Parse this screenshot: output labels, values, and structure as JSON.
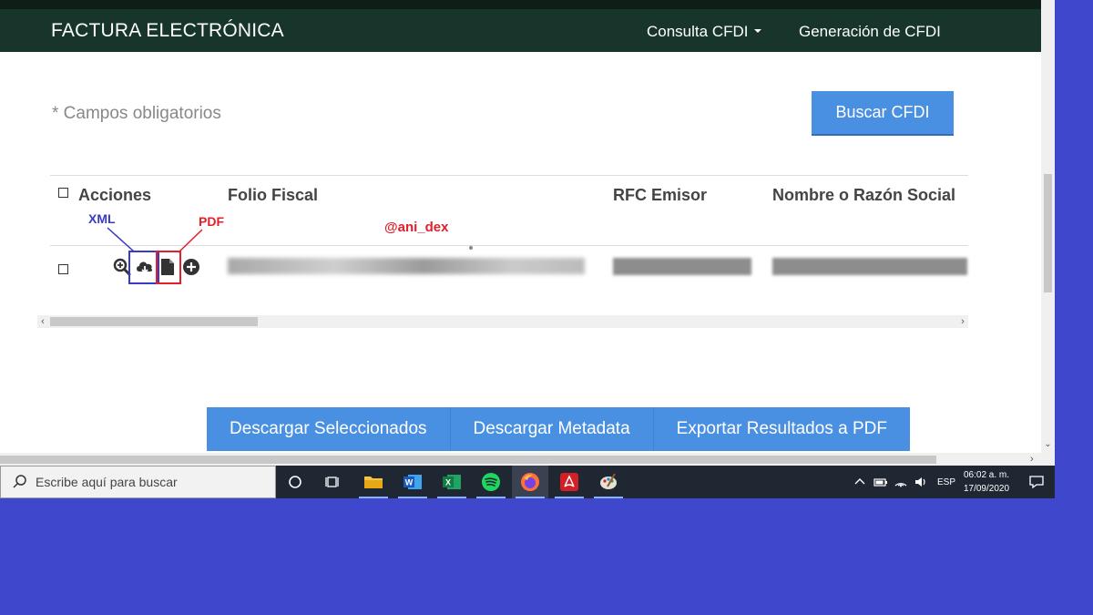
{
  "navbar": {
    "brand": "FACTURA ELECTRÓNICA",
    "menu": [
      {
        "label": "Consulta CFDI"
      },
      {
        "label": "Generación de CFDI"
      }
    ]
  },
  "form": {
    "required_note": "* Campos obligatorios",
    "search_button": "Buscar CFDI"
  },
  "table": {
    "columns": [
      "Acciones",
      "Folio Fiscal",
      "RFC Emisor",
      "Nombre o Razón Social"
    ]
  },
  "annotations": {
    "xml": "XML",
    "pdf": "PDF",
    "handle": "@ani_dex",
    "xml_color": "#3a3ac8",
    "pdf_color": "#e0202a"
  },
  "actions": [
    {
      "label": "Descargar Seleccionados"
    },
    {
      "label": "Descargar Metadata"
    },
    {
      "label": "Exportar Resultados a PDF"
    }
  ],
  "taskbar": {
    "search_placeholder": "Escribe aquí para buscar",
    "language": "ESP",
    "time": "06:02 a. m.",
    "date": "17/09/2020"
  },
  "colors": {
    "navbar": "#17352a",
    "primary_button": "#4a90e2",
    "desktop": "#3f48cc"
  }
}
